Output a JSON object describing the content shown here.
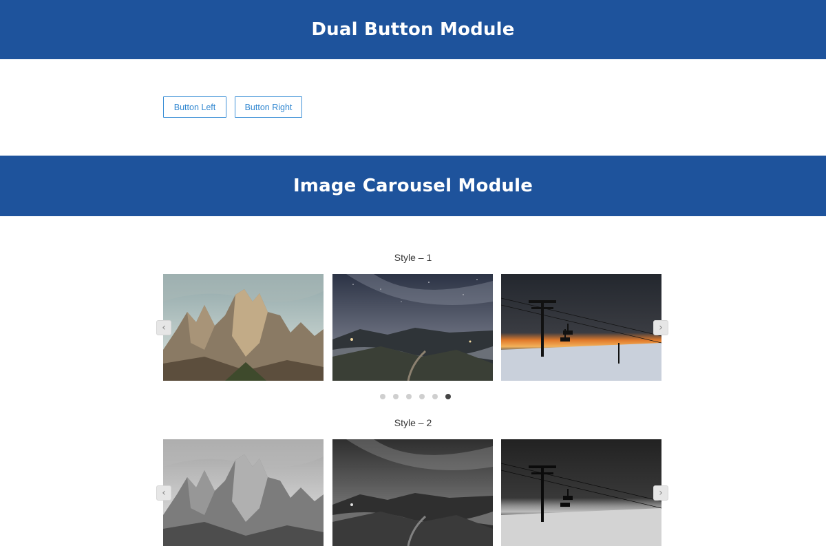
{
  "dual_button_module": {
    "title": "Dual Button Module",
    "button_left": "Button Left",
    "button_right": "Button Right"
  },
  "image_carousel_module": {
    "title": "Image Carousel Module",
    "style1": {
      "label": "Style – 1",
      "prev_arrow": "‹",
      "next_arrow": "›",
      "active_dot": 6,
      "dot_count": 6
    },
    "style2": {
      "label": "Style – 2",
      "prev_arrow": "‹",
      "next_arrow": "›"
    }
  },
  "colors": {
    "banner": "#1e539c",
    "button_border": "#3b8fd6",
    "button_text": "#2f86d0"
  }
}
